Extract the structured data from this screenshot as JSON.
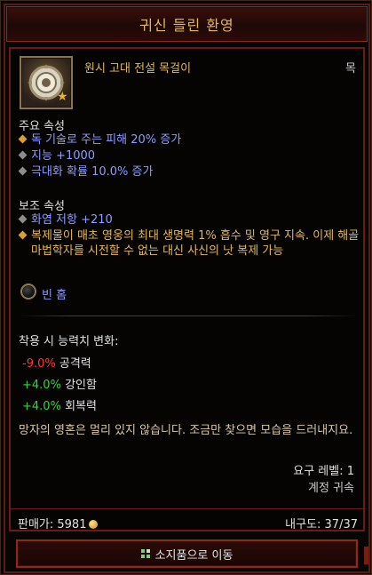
{
  "header": {
    "title": "귀신 들린 환영"
  },
  "item": {
    "name": "원시 고대 전설 목걸이",
    "slot": "목",
    "icon": "necklace-icon"
  },
  "primary": {
    "title": "주요 속성",
    "props": [
      {
        "text": "독 기술로 주는 피해 20% 증가",
        "bullet": "gold"
      },
      {
        "text": "지능 +1000",
        "bullet": "gray"
      },
      {
        "text": "극대화 확률 10.0% 증가",
        "bullet": "gray"
      }
    ]
  },
  "secondary": {
    "title": "보조 속성",
    "props": [
      {
        "text": "화염 저항 +210",
        "bullet": "gray"
      },
      {
        "text": "복제물이 매초 영웅의 최대 생명력 1% 흡수 및 영구 지속. 이제 해골 마법학자를 시전할 수 없는 대신 사신의 낫 복제 가능",
        "bullet": "gold"
      }
    ]
  },
  "socket": {
    "label": "빈 홈"
  },
  "stat_changes": {
    "title": "착용 시 능력치 변화:",
    "rows": [
      {
        "value": "-9.0%",
        "name": "공격력",
        "kind": "neg"
      },
      {
        "value": "+4.0%",
        "name": "강인함",
        "kind": "pos"
      },
      {
        "value": "+4.0%",
        "name": "회복력",
        "kind": "pos"
      }
    ]
  },
  "flavor": "망자의 영혼은 멀리 있지 않습니다. 조금만 찾으면 모습을 드러내지요.",
  "requirement": {
    "level": "요구 레벨: 1",
    "bound": "계정 귀속"
  },
  "footer": {
    "sell": "판매가: 5981",
    "durability": "내구도: 37/37"
  },
  "action": {
    "label": "소지품으로 이동"
  },
  "colors": {
    "gold": "#e2b85b",
    "blue": "#8e9bff",
    "red": "#ff3b2f",
    "green": "#3bd33b",
    "frame": "#8a2a1a"
  }
}
